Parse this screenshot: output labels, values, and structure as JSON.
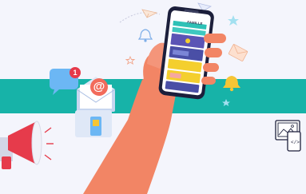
{
  "scene": {
    "phone_logo": "FAMILLE",
    "notification_count": "1",
    "email_symbol": "@"
  },
  "colors": {
    "background": "#f4f5fc",
    "band": "#17b3a8",
    "skin": "#f28565",
    "phone_frame": "#1c1f3b",
    "accent_teal": "#2ec1b6",
    "accent_purple": "#5b54b5",
    "accent_yellow": "#f4cf2e",
    "megaphone_red": "#e63b4b",
    "chat_blue": "#6cb7f4",
    "bell_yellow": "#f6c534"
  },
  "icons": [
    "megaphone-icon",
    "chat-bubble-icon",
    "email-envelope-icon",
    "paper-plane-icon",
    "bell-icon",
    "star-icon",
    "responsive-devices-icon"
  ]
}
